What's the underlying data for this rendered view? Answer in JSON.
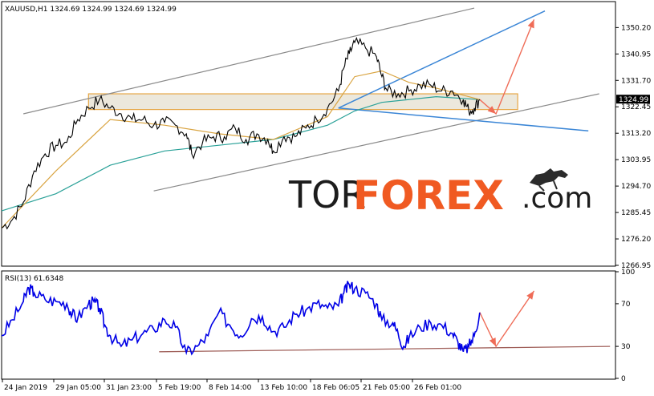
{
  "chart_data": [
    {
      "type": "candlestick",
      "header": "XAUUSD,H1  1324.69 1324.99 1324.69 1324.99",
      "symbol": "XAUUSD,H1",
      "ohlc": {
        "open": 1324.69,
        "high": 1324.99,
        "low": 1324.69,
        "close": 1324.99
      },
      "ylim": [
        1266.95,
        1359.0
      ],
      "y_ticks": [
        "1350.20",
        "1340.95",
        "1331.70",
        "1322.45",
        "1313.20",
        "1303.95",
        "1294.70",
        "1285.45",
        "1276.20",
        "1266.95"
      ],
      "current_price": "1324.99",
      "x_ticks": [
        "24 Jan 2019",
        "29 Jan 05:00",
        "31 Jan 23:00",
        "5 Feb 19:00",
        "8 Feb 14:00",
        "13 Feb 10:00",
        "18 Feb 06:05",
        "21 Feb 05:00",
        "26 Feb 01:00"
      ],
      "price_path": [
        [
          0,
          1280
        ],
        [
          2,
          1283
        ],
        [
          4,
          1289
        ],
        [
          6,
          1300
        ],
        [
          8,
          1306
        ],
        [
          10,
          1309
        ],
        [
          12,
          1310
        ],
        [
          14,
          1318
        ],
        [
          16,
          1322
        ],
        [
          18,
          1325
        ],
        [
          20,
          1322
        ],
        [
          22,
          1320
        ],
        [
          24,
          1318
        ],
        [
          26,
          1318
        ],
        [
          28,
          1316
        ],
        [
          30,
          1317
        ],
        [
          32,
          1316
        ],
        [
          34,
          1313
        ],
        [
          35,
          1306
        ],
        [
          37,
          1310
        ],
        [
          39,
          1312
        ],
        [
          41,
          1312
        ],
        [
          43,
          1315
        ],
        [
          45,
          1311
        ],
        [
          47,
          1313
        ],
        [
          49,
          1311
        ],
        [
          50,
          1307
        ],
        [
          52,
          1312
        ],
        [
          54,
          1312
        ],
        [
          56,
          1315
        ],
        [
          58,
          1318
        ],
        [
          60,
          1322
        ],
        [
          62,
          1328
        ],
        [
          63,
          1336
        ],
        [
          64,
          1341
        ],
        [
          65,
          1345
        ],
        [
          67,
          1343
        ],
        [
          69,
          1340
        ],
        [
          70,
          1333
        ],
        [
          71,
          1328
        ],
        [
          73,
          1327
        ],
        [
          75,
          1328
        ],
        [
          77,
          1330
        ],
        [
          79,
          1330
        ],
        [
          81,
          1328
        ],
        [
          83,
          1328
        ],
        [
          85,
          1325
        ],
        [
          86,
          1321
        ],
        [
          87,
          1322
        ],
        [
          88,
          1324.99
        ]
      ],
      "ma_fast": [
        [
          0,
          1280
        ],
        [
          10,
          1300
        ],
        [
          20,
          1318
        ],
        [
          30,
          1316
        ],
        [
          40,
          1313
        ],
        [
          50,
          1311
        ],
        [
          60,
          1319
        ],
        [
          65,
          1333
        ],
        [
          70,
          1335
        ],
        [
          75,
          1331
        ],
        [
          80,
          1329
        ],
        [
          88,
          1325
        ]
      ],
      "ma_slow": [
        [
          0,
          1286
        ],
        [
          10,
          1292
        ],
        [
          20,
          1302
        ],
        [
          30,
          1307
        ],
        [
          40,
          1309
        ],
        [
          50,
          1311
        ],
        [
          60,
          1316
        ],
        [
          65,
          1321
        ],
        [
          70,
          1324
        ],
        [
          75,
          1325
        ],
        [
          80,
          1326
        ],
        [
          88,
          1325
        ]
      ],
      "resistance_zone": [
        1321.5,
        1327.0
      ],
      "channel_upper": [
        [
          4,
          1320
        ],
        [
          87,
          1357
        ]
      ],
      "channel_lower": [
        [
          28,
          1293
        ],
        [
          110,
          1327
        ]
      ],
      "blue_upper": [
        [
          62,
          1322
        ],
        [
          100,
          1356
        ]
      ],
      "blue_lower": [
        [
          62,
          1322
        ],
        [
          108,
          1314
        ]
      ],
      "forecast_path": [
        [
          88,
          1325
        ],
        [
          91,
          1320
        ],
        [
          98,
          1353
        ]
      ]
    },
    {
      "type": "line",
      "header": "RSI(13) 61.6348",
      "indicator": "RSI(13)",
      "value": 61.6348,
      "ylim": [
        0,
        100
      ],
      "y_ticks": [
        "100",
        "70",
        "30",
        "0"
      ],
      "rsi_path": [
        [
          0,
          40
        ],
        [
          2,
          55
        ],
        [
          4,
          72
        ],
        [
          5,
          85
        ],
        [
          6,
          80
        ],
        [
          8,
          74
        ],
        [
          10,
          72
        ],
        [
          12,
          70
        ],
        [
          13,
          60
        ],
        [
          14,
          56
        ],
        [
          16,
          70
        ],
        [
          17,
          72
        ],
        [
          18,
          66
        ],
        [
          19,
          50
        ],
        [
          20,
          40
        ],
        [
          22,
          30
        ],
        [
          24,
          36
        ],
        [
          26,
          42
        ],
        [
          28,
          46
        ],
        [
          30,
          55
        ],
        [
          32,
          48
        ],
        [
          34,
          24
        ],
        [
          36,
          30
        ],
        [
          38,
          40
        ],
        [
          40,
          62
        ],
        [
          42,
          50
        ],
        [
          44,
          40
        ],
        [
          46,
          56
        ],
        [
          48,
          58
        ],
        [
          50,
          44
        ],
        [
          52,
          48
        ],
        [
          54,
          60
        ],
        [
          56,
          64
        ],
        [
          58,
          70
        ],
        [
          60,
          66
        ],
        [
          62,
          68
        ],
        [
          63,
          80
        ],
        [
          64,
          88
        ],
        [
          65,
          84
        ],
        [
          67,
          80
        ],
        [
          69,
          70
        ],
        [
          70,
          55
        ],
        [
          72,
          52
        ],
        [
          73,
          42
        ],
        [
          74,
          30
        ],
        [
          75,
          38
        ],
        [
          77,
          48
        ],
        [
          79,
          52
        ],
        [
          81,
          50
        ],
        [
          83,
          42
        ],
        [
          84,
          34
        ],
        [
          85,
          25
        ],
        [
          86,
          30
        ],
        [
          87,
          40
        ],
        [
          88,
          61.63
        ]
      ],
      "rsi_support": [
        [
          29,
          25
        ],
        [
          112,
          30
        ]
      ],
      "forecast_path": [
        [
          88,
          62
        ],
        [
          91,
          30
        ],
        [
          98,
          82
        ]
      ]
    }
  ],
  "logo": {
    "tor": "TOR",
    "forex": "FOREX",
    "com": ".com"
  },
  "colors": {
    "price": "#000000",
    "ma_fast": "#d9a441",
    "ma_slow": "#2aa198",
    "rsi": "#0000e6",
    "channel": "#8a8a8a",
    "blue_lines": "#3b86d6",
    "forecast": "#ef6c57",
    "zone_fill": "#e9e4d6",
    "zone_stroke": "#e6a644",
    "rsi_support": "#a0605a",
    "logo_orange": "#f05a22"
  }
}
